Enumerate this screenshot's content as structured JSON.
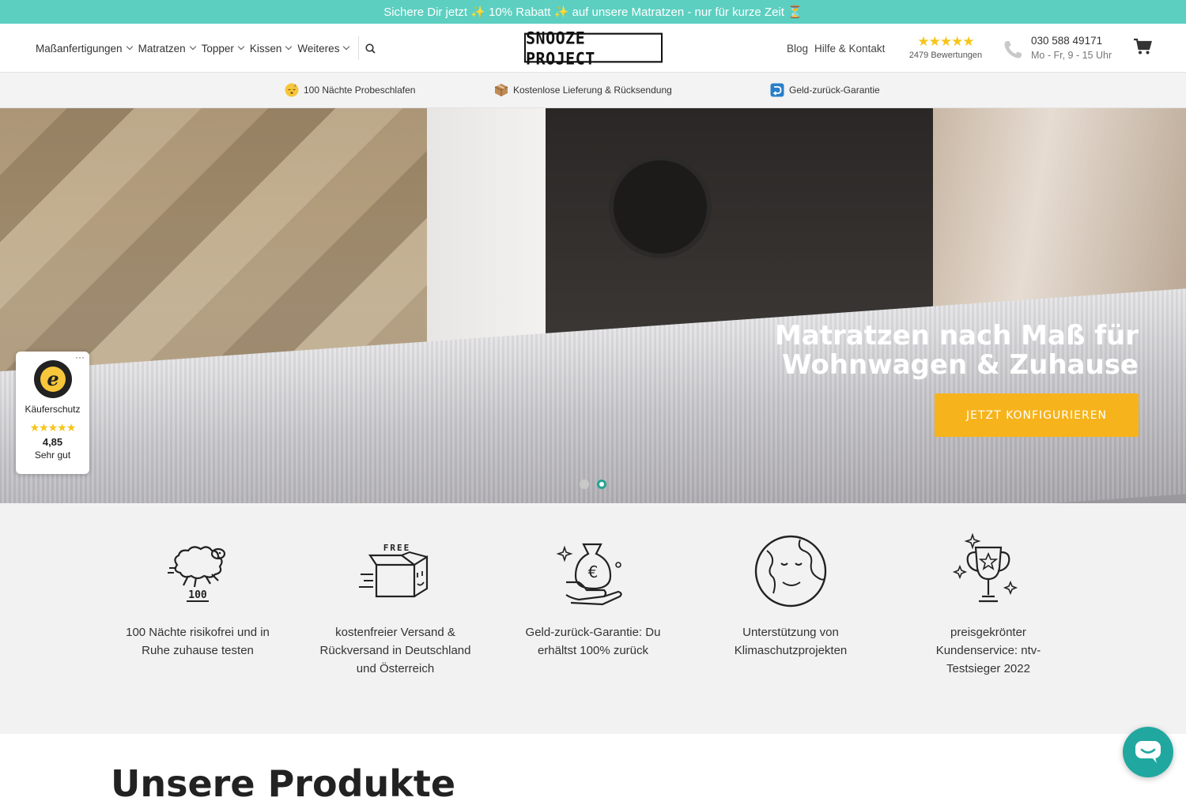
{
  "promo": {
    "text": "Sichere Dir jetzt ✨ 10% Rabatt ✨ auf unsere Matratzen - nur für kurze Zeit ⏳"
  },
  "header": {
    "nav": [
      {
        "label": "Maßanfertigungen"
      },
      {
        "label": "Matratzen"
      },
      {
        "label": "Topper"
      },
      {
        "label": "Kissen"
      },
      {
        "label": "Weiteres"
      }
    ],
    "search_icon": "search-icon",
    "logo_text": "SNOOZE PROJECT",
    "links": {
      "blog": "Blog",
      "help": "Hilfe & Kontakt"
    },
    "rating": {
      "stars": "★★★★★",
      "count": "2479 Bewertungen"
    },
    "phone": {
      "number": "030 588 49171",
      "hours": "Mo - Fr, 9 - 15 Uhr"
    },
    "cart_icon": "cart-icon"
  },
  "usps": [
    {
      "icon": "sleep-emoji-icon",
      "label": "100 Nächte Probeschlafen"
    },
    {
      "icon": "package-icon",
      "label": "Kostenlose Lieferung & Rücksendung"
    },
    {
      "icon": "money-back-icon",
      "label": "Geld-zurück-Garantie"
    }
  ],
  "hero": {
    "title_line1": "Matratzen nach Maß für",
    "title_line2": "Wohnwagen & Zuhause",
    "cta": "JETZT KONFIGURIEREN",
    "slides": 2,
    "active_slide": 2,
    "colors": {
      "cta": "#f7b31b",
      "active_dot": "#23a595"
    }
  },
  "trust_badge": {
    "more": "···",
    "label": "Käuferschutz",
    "stars": "★★★★★",
    "score": "4,85",
    "grade": "Sehr gut"
  },
  "features": [
    {
      "icon": "sheep-icon",
      "text": "100 Nächte risikofrei und in Ruhe zuhause testen"
    },
    {
      "icon": "free-box-icon",
      "text": "kostenfreier Versand & Rückversand in Deutschland und Österreich"
    },
    {
      "icon": "money-bag-icon",
      "text": "Geld-zurück-Garantie: Du erhältst 100% zurück"
    },
    {
      "icon": "globe-icon",
      "text": "Unterstützung von Klimaschutzprojekten"
    },
    {
      "icon": "trophy-icon",
      "text": "preisgekrönter Kundenservice: ntv-Testsieger 2022"
    }
  ],
  "products": {
    "title": "Unsere Produkte"
  },
  "colors": {
    "promo": "#5ccfc0",
    "chat": "#20a8a0",
    "stars": "#f5c518"
  }
}
